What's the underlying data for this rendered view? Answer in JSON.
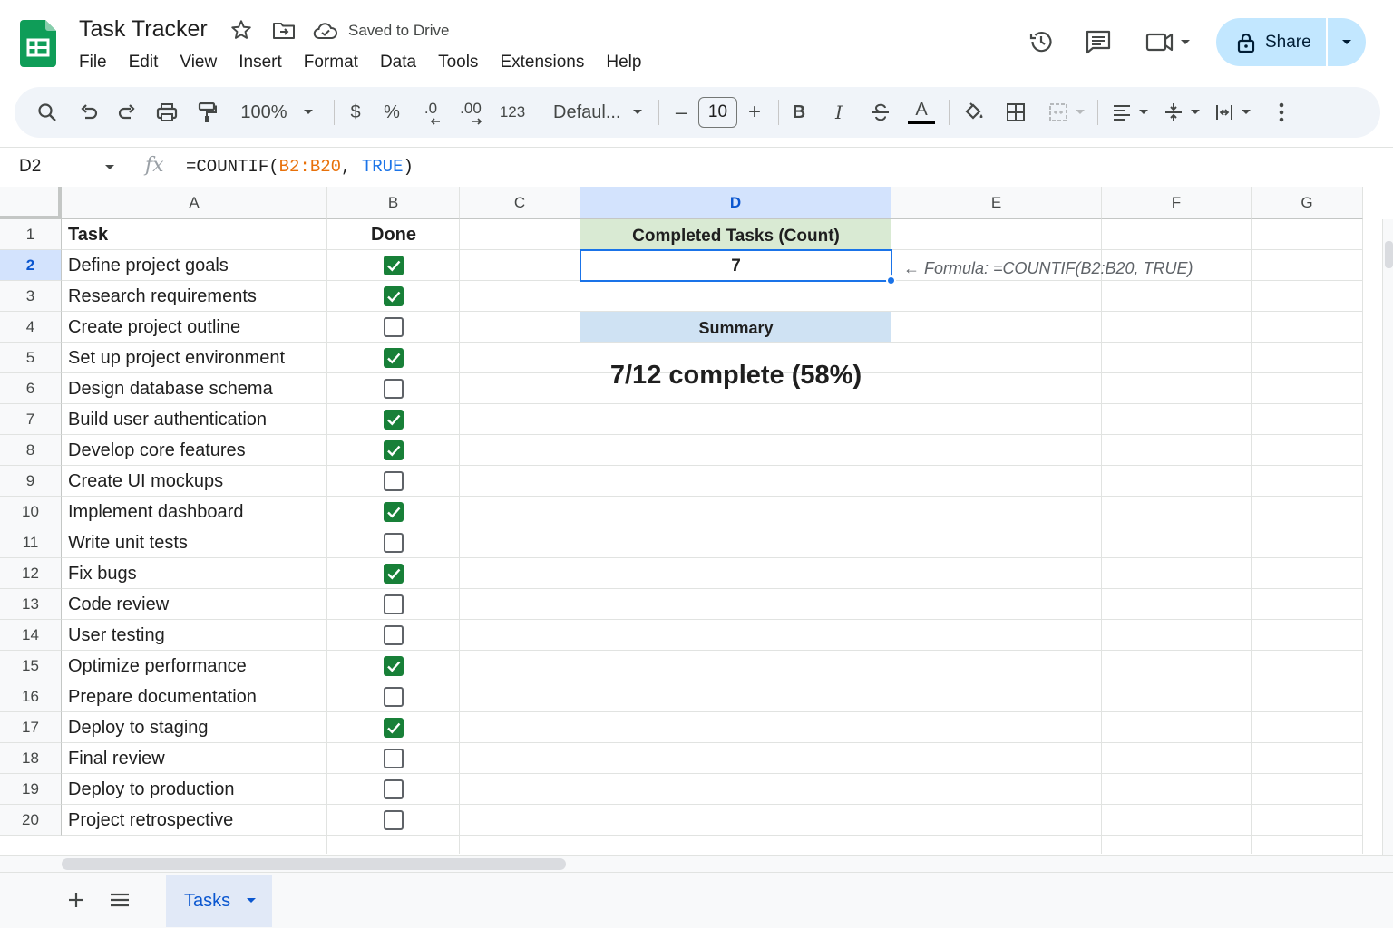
{
  "app": {
    "title": "Task Tracker",
    "save_status": "Saved to Drive",
    "share_label": "Share"
  },
  "menu": [
    "File",
    "Edit",
    "View",
    "Insert",
    "Format",
    "Data",
    "Tools",
    "Extensions",
    "Help"
  ],
  "toolbar": {
    "zoom": "100%",
    "currency": "$",
    "percent": "%",
    "dec_decrease": ".0",
    "dec_increase": ".00",
    "number_format": "123",
    "font": "Defaul...",
    "font_size": "10",
    "minus": "–",
    "plus": "+",
    "bold": "B",
    "italic": "I",
    "text_color_letter": "A"
  },
  "formula_bar": {
    "cell_ref": "D2",
    "fx": "fx",
    "formula_prefix": "=COUNTIF(",
    "formula_range": "B2:B20",
    "formula_sep": ", ",
    "formula_bool": "TRUE",
    "formula_suffix": ")"
  },
  "columns": [
    "A",
    "B",
    "C",
    "D",
    "E",
    "F",
    "G"
  ],
  "selected_column": "D",
  "selected_row": "2",
  "header_row": {
    "task": "Task",
    "done": "Done"
  },
  "tasks": [
    {
      "row": "2",
      "name": "Define project goals",
      "done": true
    },
    {
      "row": "3",
      "name": "Research requirements",
      "done": true
    },
    {
      "row": "4",
      "name": "Create project outline",
      "done": false
    },
    {
      "row": "5",
      "name": "Set up project environment",
      "done": true
    },
    {
      "row": "6",
      "name": "Design database schema",
      "done": false
    },
    {
      "row": "7",
      "name": "Build user authentication",
      "done": true
    },
    {
      "row": "8",
      "name": "Develop core features",
      "done": true
    },
    {
      "row": "9",
      "name": "Create UI mockups",
      "done": false
    },
    {
      "row": "10",
      "name": "Implement dashboard",
      "done": true
    },
    {
      "row": "11",
      "name": "Write unit tests",
      "done": false
    },
    {
      "row": "12",
      "name": "Fix bugs",
      "done": true
    },
    {
      "row": "13",
      "name": "Code review",
      "done": false
    },
    {
      "row": "14",
      "name": "User testing",
      "done": false
    },
    {
      "row": "15",
      "name": "Optimize performance",
      "done": true
    },
    {
      "row": "16",
      "name": "Prepare documentation",
      "done": false
    },
    {
      "row": "17",
      "name": "Deploy to staging",
      "done": true
    },
    {
      "row": "18",
      "name": "Final review",
      "done": false
    },
    {
      "row": "19",
      "name": "Deploy to production",
      "done": false
    },
    {
      "row": "20",
      "name": "Project retrospective",
      "done": false
    }
  ],
  "summary": {
    "count_header": "Completed Tasks (Count)",
    "count_value": "7",
    "formula_note": "← Formula: =COUNTIF(B2:B20, TRUE)",
    "summary_header": "Summary",
    "summary_text": "7/12 complete (58%)"
  },
  "sheets": {
    "active_tab": "Tasks"
  },
  "colors": {
    "checkbox_checked": "#188038",
    "selection": "#1a73e8",
    "count_header_bg": "#d9ead3",
    "summary_header_bg": "#cfe2f3",
    "share_bg": "#c2e7ff"
  }
}
